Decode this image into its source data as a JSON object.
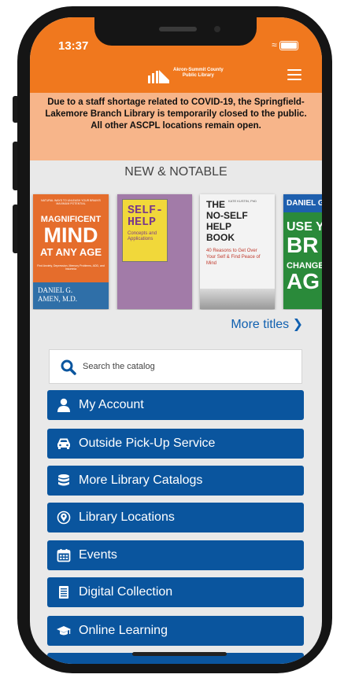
{
  "status_bar": {
    "time": "13:37"
  },
  "header": {
    "logo_line1": "Akron-Summit County",
    "logo_line2": "Public Library"
  },
  "alert": {
    "text": "Due to a staff shortage related to COVID-19, the Springfield-Lakemore Branch Library is temporarily closed to the public. All other ASCPL locations remain open."
  },
  "new_notable": {
    "title": "NEW & NOTABLE",
    "books": [
      {
        "small_top": "NATURAL WAYS TO UNLEASH YOUR BRAIN'S MAXIMUM POTENTIAL",
        "title_lines": [
          "MAGNIFICENT",
          "MIND",
          "AT ANY AGE"
        ],
        "bottom": "Find Anxiety, Depression, Memory Problems, ADD, and Insomnia",
        "author": "DANIEL G. AMEN, M.D."
      },
      {
        "title_lines": [
          "SELF-",
          "HELP"
        ],
        "subtitle": "Concepts and Applications"
      },
      {
        "title_lines": [
          "THE",
          "NO-SELF",
          "HELP",
          "BOOK"
        ],
        "author": "KATE KUSTIN, PhD",
        "subtitle": "40 Reasons to Get Over Your Self & Find Peace of Mind"
      },
      {
        "title_lines": [
          "DANIEL G",
          "USE Y",
          "BR",
          "CHANGE",
          "AG"
        ]
      }
    ],
    "more_label": "More titles"
  },
  "search": {
    "placeholder": "Search the catalog"
  },
  "nav": [
    {
      "label": "My Account",
      "icon": "user-icon"
    },
    {
      "label": "Outside Pick-Up Service",
      "icon": "car-icon"
    },
    {
      "label": "More Library Catalogs",
      "icon": "database-icon"
    },
    {
      "label": "Library Locations",
      "icon": "location-icon"
    },
    {
      "label": "Events",
      "icon": "calendar-icon"
    },
    {
      "label": "Digital Collection",
      "icon": "document-icon"
    },
    {
      "label": "Online Learning",
      "icon": "graduation-cap-icon"
    }
  ],
  "colors": {
    "header": "#f0781e",
    "alert_bg": "#f7b58a",
    "nav_button": "#0a559e",
    "link": "#1060b0"
  }
}
